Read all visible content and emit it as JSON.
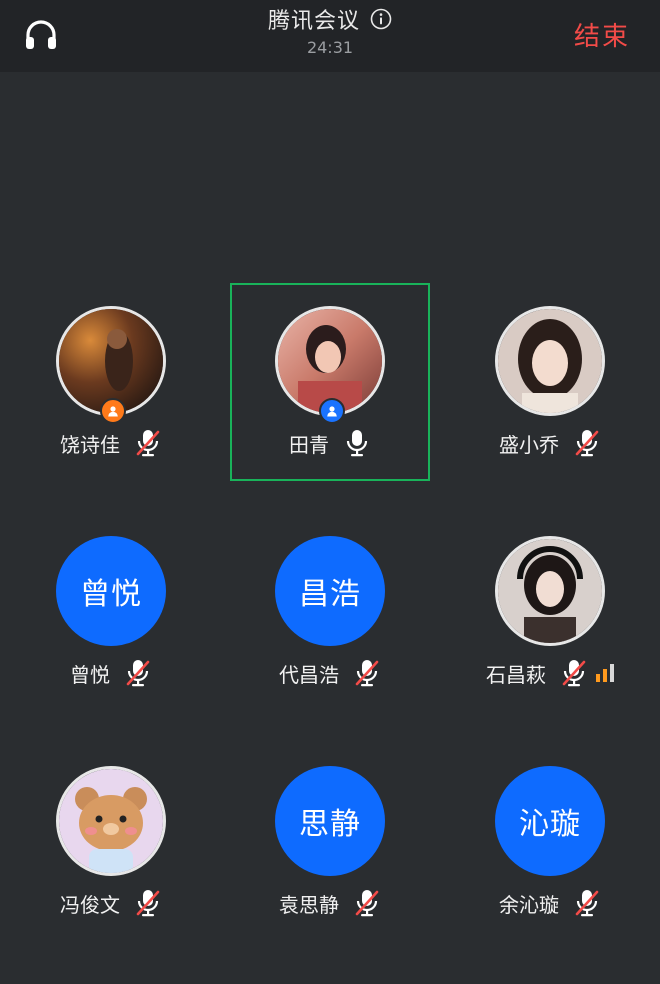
{
  "header": {
    "title": "腾讯会议",
    "timer": "24:31",
    "end_label": "结束",
    "left_icon": "headphone-icon",
    "info_icon": "info-icon"
  },
  "colors": {
    "accent_blue": "#0e6bff",
    "end_red": "#f24b48",
    "speaking_green": "#19b35a",
    "host_orange": "#ff7a1a",
    "cohost_blue": "#1a73ff",
    "signal_orange": "#ff9a1e",
    "background": "#2a2d30"
  },
  "participants": [
    {
      "name": "饶诗佳",
      "avatar": "photo",
      "role": "host",
      "muted": true
    },
    {
      "name": "田青",
      "avatar": "photo",
      "role": "cohost",
      "muted": false,
      "speaking": true
    },
    {
      "name": "盛小乔",
      "avatar": "photo",
      "muted": true
    },
    {
      "name": "曾悦",
      "avatar": "text",
      "initials": "曾悦",
      "muted": true
    },
    {
      "name": "代昌浩",
      "avatar": "text",
      "initials": "昌浩",
      "muted": true
    },
    {
      "name": "石昌萩",
      "avatar": "photo",
      "muted": true,
      "signal_bars": 2
    },
    {
      "name": "冯俊文",
      "avatar": "photo",
      "muted": true
    },
    {
      "name": "袁思静",
      "avatar": "text",
      "initials": "思静",
      "muted": true
    },
    {
      "name": "余沁璇",
      "avatar": "text",
      "initials": "沁璇",
      "muted": true
    }
  ]
}
